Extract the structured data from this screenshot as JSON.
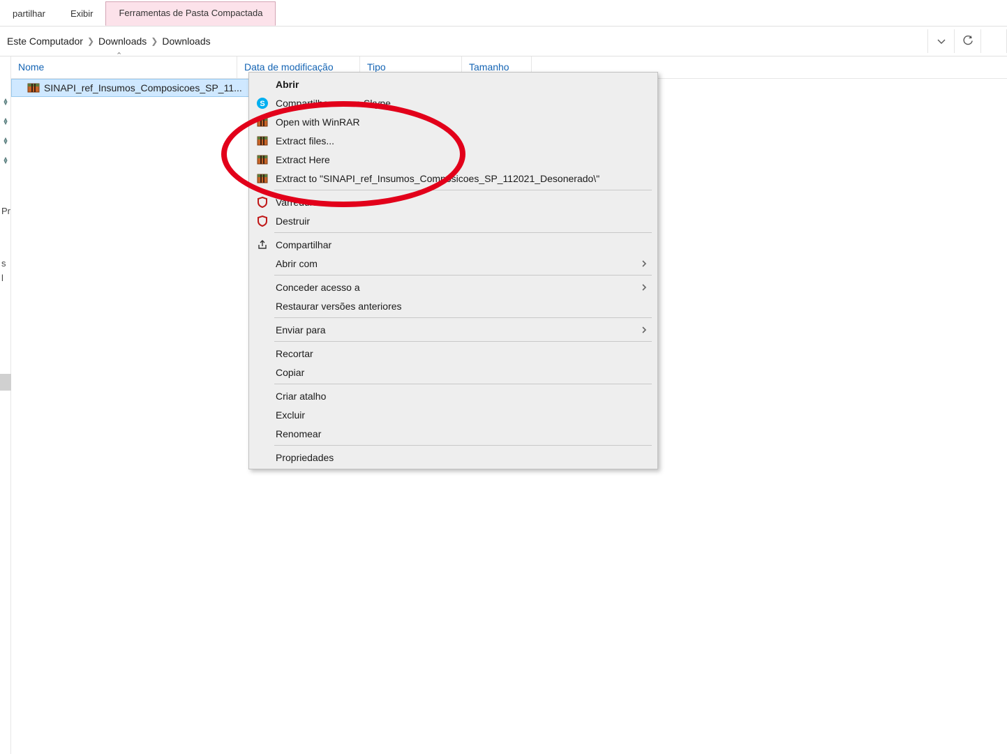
{
  "ribbon": {
    "tabs": [
      "partilhar",
      "Exibir",
      "Ferramentas de Pasta Compactada"
    ]
  },
  "breadcrumb": {
    "items": [
      "Este Computador",
      "Downloads",
      "Downloads"
    ]
  },
  "columns": {
    "name": "Nome",
    "date": "Data de modificação",
    "type": "Tipo",
    "size": "Tamanho"
  },
  "sidebar": {
    "quick_labels": [
      "",
      "",
      "",
      "",
      "Pr",
      "s",
      "l"
    ]
  },
  "file": {
    "name": "SINAPI_ref_Insumos_Composicoes_SP_11..."
  },
  "context_menu": {
    "open": "Abrir",
    "skype": "Compartilhar com o Skype",
    "open_winrar": "Open with WinRAR",
    "extract_files": "Extract files...",
    "extract_here": "Extract Here",
    "extract_to": "Extract to \"SINAPI_ref_Insumos_Composicoes_SP_112021_Desonerado\\\"",
    "scan": "Varredura",
    "destroy": "Destruir",
    "share": "Compartilhar",
    "open_with": "Abrir com",
    "give_access": "Conceder acesso a",
    "restore_prev": "Restaurar versões anteriores",
    "send_to": "Enviar para",
    "cut": "Recortar",
    "copy": "Copiar",
    "shortcut": "Criar atalho",
    "delete": "Excluir",
    "rename": "Renomear",
    "properties": "Propriedades"
  }
}
